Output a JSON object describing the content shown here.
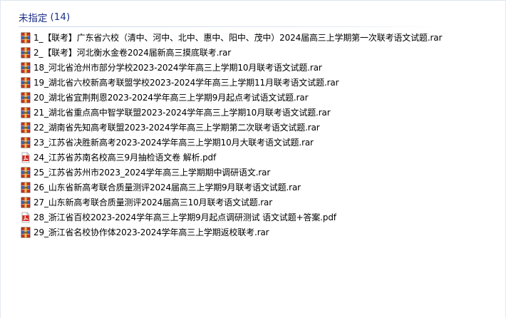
{
  "group": {
    "title": "未指定",
    "count": "(14)"
  },
  "files": [
    {
      "name": "1_【联考】广东省六校（清中、河中、北中、惠中、阳中、茂中）2024届高三上学期第一次联考语文试题.rar",
      "icon": "rar-archive-icon"
    },
    {
      "name": "2_【联考】河北衡水金卷2024届新高三摸底联考.rar",
      "icon": "rar-archive-icon"
    },
    {
      "name": "18_河北省沧州市部分学校2023-2024学年高三上学期10月联考语文试题.rar",
      "icon": "rar-archive-icon"
    },
    {
      "name": "19_湖北省六校新高考联盟学校2023-2024学年高三上学期11月联考语文试题.rar",
      "icon": "rar-archive-icon"
    },
    {
      "name": "20_湖北省宜荆荆恩2023-2024学年高三上学期9月起点考试语文试题.rar",
      "icon": "rar-archive-icon"
    },
    {
      "name": "21_湖北省重点高中智学联盟2023-2024学年高三上学期10月联考语文试题.rar",
      "icon": "rar-archive-icon"
    },
    {
      "name": "22_湖南省先知高考联盟2023-2024学年高三上学期第二次联考语文试题.rar",
      "icon": "rar-archive-icon"
    },
    {
      "name": "23_江苏省决胜新高考2023-2024学年高三上学期10月大联考语文试题.rar",
      "icon": "rar-archive-icon"
    },
    {
      "name": "24_江苏省苏南名校高三9月抽检语文卷 解析.pdf",
      "icon": "pdf-file-icon"
    },
    {
      "name": "25_江苏省苏州市2023_2024学年高三上学期期中调研语文.rar",
      "icon": "rar-archive-icon"
    },
    {
      "name": "26_山东省新高考联合质量测评2024届高三上学期9月联考语文试题.rar",
      "icon": "rar-archive-icon"
    },
    {
      "name": "27_山东新高考联合质量测评2024届高三10月联考语文试题.rar",
      "icon": "rar-archive-icon"
    },
    {
      "name": "28_浙江省百校2023-2024学年高三上学期9月起点调研测试  语文试题+答案.pdf",
      "icon": "pdf-file-icon"
    },
    {
      "name": "29_浙江省名校协作体2023-2024学年高三上学期返校联考.rar",
      "icon": "rar-archive-icon"
    }
  ],
  "colors": {
    "group_header": "#1e3287",
    "rar_red": "#c8352e",
    "rar_blue": "#3f5fb4",
    "rar_yellow": "#f2c13b",
    "pdf_red": "#d7261f"
  }
}
